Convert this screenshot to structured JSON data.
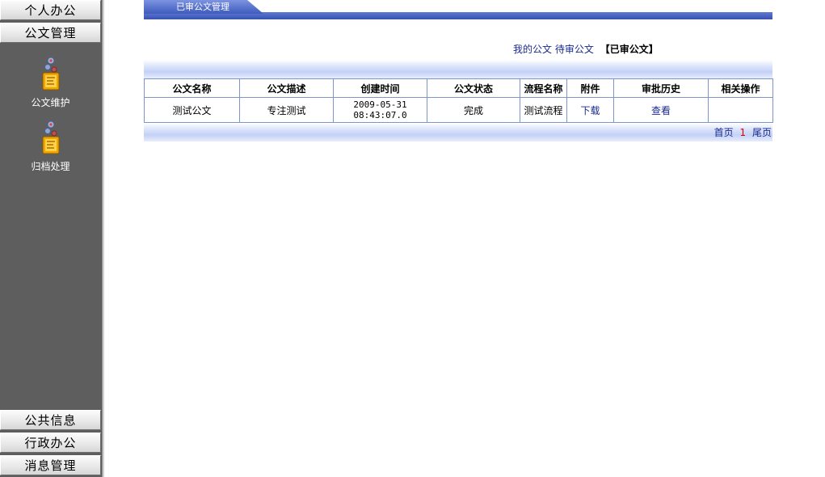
{
  "sidebar": {
    "top_items": [
      {
        "label": "个人办公"
      },
      {
        "label": "公文管理"
      }
    ],
    "tools": [
      {
        "label": "公文维护",
        "icon": "document-maintenance-icon"
      },
      {
        "label": "归档处理",
        "icon": "archive-processing-icon"
      }
    ],
    "bottom_items": [
      {
        "label": "公共信息"
      },
      {
        "label": "行政办公"
      },
      {
        "label": "消息管理"
      }
    ]
  },
  "header": {
    "tab_label": "已审公文管理"
  },
  "sublinks": {
    "my_docs": "我的公文",
    "pending_docs": "待审公文",
    "current": "【已审公文】"
  },
  "table": {
    "columns": [
      "公文名称",
      "公文描述",
      "创建时间",
      "公文状态",
      "流程名称",
      "附件",
      "审批历史",
      "相关操作"
    ],
    "rows": [
      {
        "name": "测试公文",
        "description": "专注测试",
        "created_date": "2009-05-31",
        "created_time": "08:43:07.0",
        "status": "完成",
        "flow": "测试流程",
        "attachment": "下载",
        "history": "查看",
        "operations": ""
      }
    ]
  },
  "pager": {
    "first": "首页",
    "current_page": "1",
    "last": "尾页"
  },
  "colors": {
    "sidebar_bg": "#5e5e5e",
    "tab_blue": "#3f5bbd",
    "link_blue": "#1a2a8c",
    "table_border": "#7d95c9",
    "page_number_red": "#e00000"
  }
}
